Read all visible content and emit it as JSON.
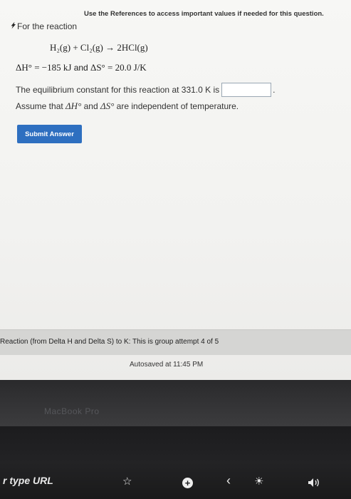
{
  "header": {
    "references_note": "Use the References to access important values if needed for this question."
  },
  "question": {
    "intro": "For the reaction",
    "equation": {
      "lhs": "H₂(g) + Cl₂(g)",
      "arrow": "→",
      "rhs": "2HCl(g)"
    },
    "thermo": {
      "dH_symbol": "ΔH°",
      "dH_value": "= −185 kJ",
      "and": "and",
      "dS_symbol": "ΔS°",
      "dS_value": "= 20.0 J/K"
    },
    "prompt_text": "The equilibrium constant for this reaction at 331.0 K is",
    "answer_value": "",
    "period": ".",
    "assume": {
      "pre": "Assume that",
      "dH": "ΔH°",
      "and": "and",
      "dS": "ΔS°",
      "post": "are independent of temperature."
    }
  },
  "buttons": {
    "submit_label": "Submit Answer"
  },
  "status": {
    "group_attempt": "Reaction (from Delta H and Delta S) to K: This is group attempt 4 of 5",
    "autosaved": "Autosaved at 11:45 PM"
  },
  "laptop": {
    "brand": "MacBook Pro"
  },
  "touchbar": {
    "url_hint": "r type URL",
    "icons": [
      "star-icon",
      "plus-circle-icon",
      "chevron-left-icon",
      "brightness-icon",
      "volume-icon"
    ]
  }
}
